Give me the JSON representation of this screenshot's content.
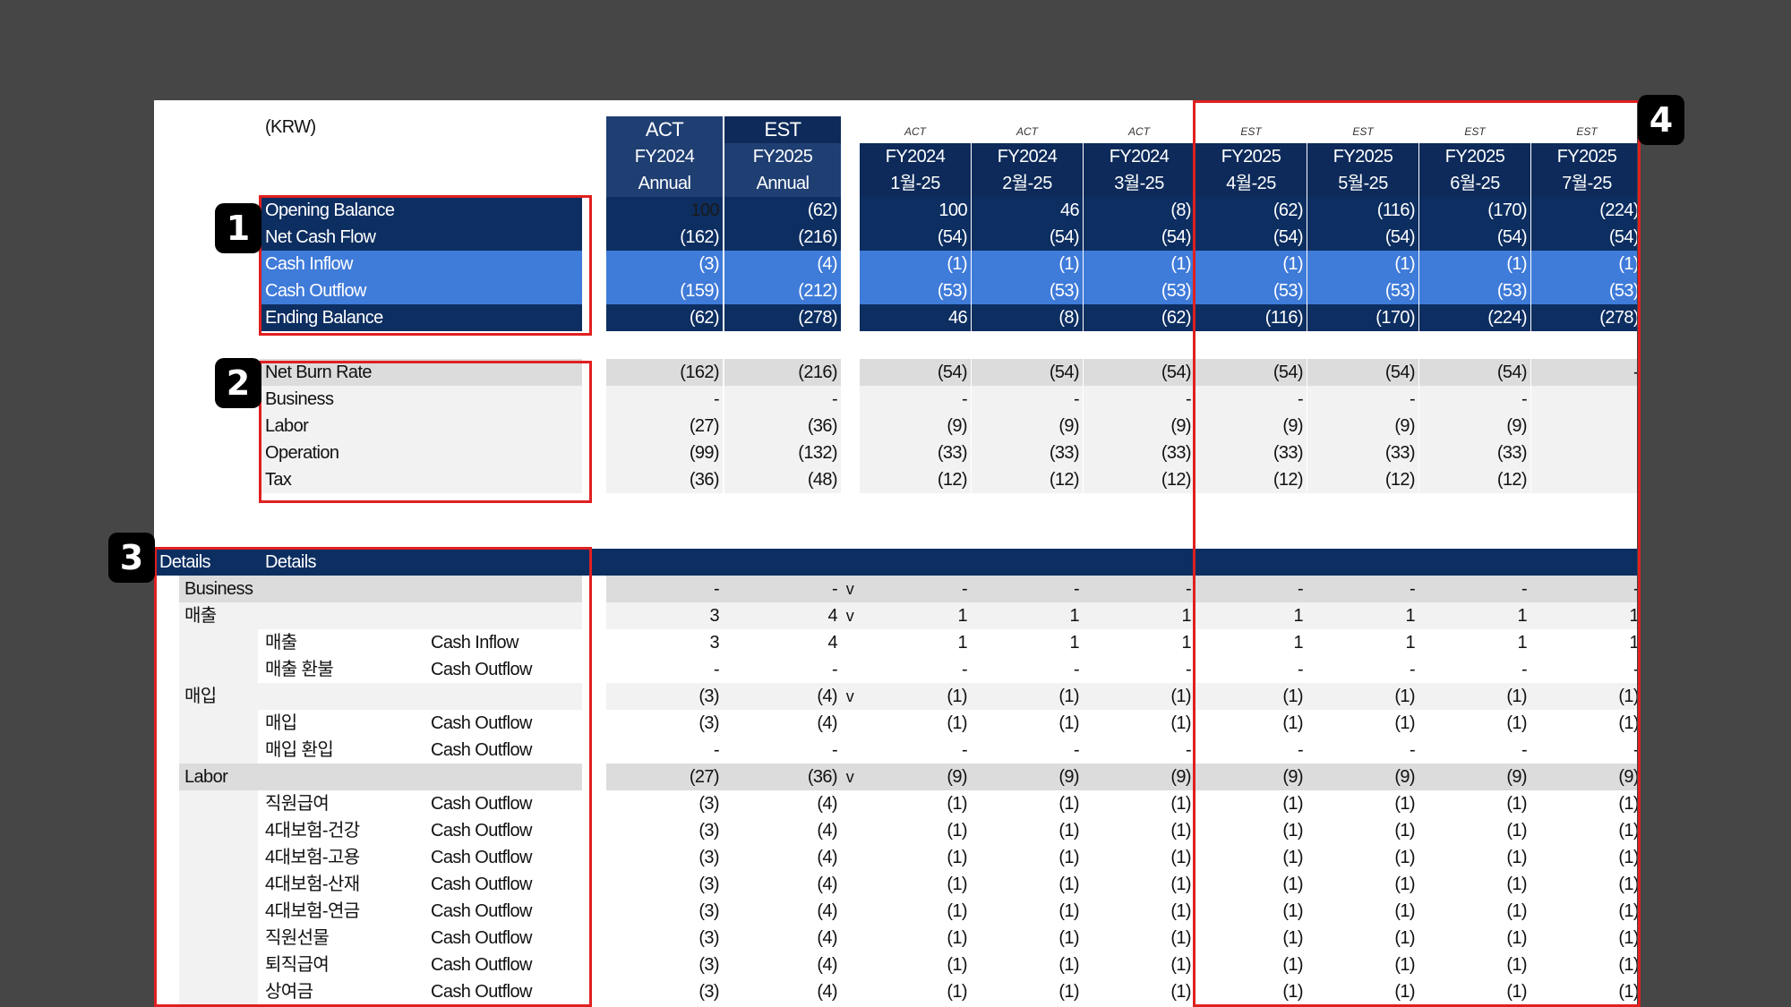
{
  "unit_label": "(KRW)",
  "headers": {
    "summary": [
      {
        "type": "ACT",
        "fy": "FY2024",
        "period": "Annual"
      },
      {
        "type": "EST",
        "fy": "FY2025",
        "period": "Annual"
      }
    ],
    "months": [
      {
        "tag": "ACT",
        "fy": "FY2024",
        "month": "1월-25"
      },
      {
        "tag": "ACT",
        "fy": "FY2024",
        "month": "2월-25"
      },
      {
        "tag": "ACT",
        "fy": "FY2024",
        "month": "3월-25"
      },
      {
        "tag": "EST",
        "fy": "FY2025",
        "month": "4월-25"
      },
      {
        "tag": "EST",
        "fy": "FY2025",
        "month": "5월-25"
      },
      {
        "tag": "EST",
        "fy": "FY2025",
        "month": "6월-25"
      },
      {
        "tag": "EST",
        "fy": "FY2025",
        "month": "7월-25"
      }
    ]
  },
  "balance_rows": [
    {
      "label": "Opening Balance",
      "style": "dark",
      "values": [
        "100",
        "(62)",
        "100",
        "46",
        "(8)",
        "(62)",
        "(116)",
        "(170)",
        "(224)"
      ]
    },
    {
      "label": "Net Cash Flow",
      "style": "dark",
      "values": [
        "(162)",
        "(216)",
        "(54)",
        "(54)",
        "(54)",
        "(54)",
        "(54)",
        "(54)",
        "(54)"
      ]
    },
    {
      "label": "Cash Inflow",
      "style": "blue",
      "values": [
        "(3)",
        "(4)",
        "(1)",
        "(1)",
        "(1)",
        "(1)",
        "(1)",
        "(1)",
        "(1)"
      ]
    },
    {
      "label": "Cash Outflow",
      "style": "blue",
      "values": [
        "(159)",
        "(212)",
        "(53)",
        "(53)",
        "(53)",
        "(53)",
        "(53)",
        "(53)",
        "(53)"
      ]
    },
    {
      "label": "Ending Balance",
      "style": "dark",
      "values": [
        "(62)",
        "(278)",
        "46",
        "(8)",
        "(62)",
        "(116)",
        "(170)",
        "(224)",
        "(278)"
      ]
    }
  ],
  "burn_rows": [
    {
      "label": "Net Burn Rate",
      "style": "grey",
      "values": [
        "(162)",
        "(216)",
        "(54)",
        "(54)",
        "(54)",
        "(54)",
        "(54)",
        "(54)",
        "-"
      ]
    },
    {
      "label": "Business",
      "style": "light",
      "values": [
        "-",
        "-",
        "-",
        "-",
        "-",
        "-",
        "-",
        "-",
        ""
      ]
    },
    {
      "label": "Labor",
      "style": "light",
      "values": [
        "(27)",
        "(36)",
        "(9)",
        "(9)",
        "(9)",
        "(9)",
        "(9)",
        "(9)",
        ""
      ]
    },
    {
      "label": "Operation",
      "style": "light",
      "values": [
        "(99)",
        "(132)",
        "(33)",
        "(33)",
        "(33)",
        "(33)",
        "(33)",
        "(33)",
        ""
      ]
    },
    {
      "label": "Tax",
      "style": "light",
      "values": [
        "(36)",
        "(48)",
        "(12)",
        "(12)",
        "(12)",
        "(12)",
        "(12)",
        "(12)",
        ""
      ]
    }
  ],
  "details_header": {
    "a": "Details",
    "b": "Details"
  },
  "detail_rows": [
    {
      "kind": "section",
      "label": "Business",
      "values": [
        "-",
        "-",
        "-",
        "-",
        "-",
        "-",
        "-",
        "-",
        "-"
      ],
      "mark": "v"
    },
    {
      "kind": "group",
      "label": "매출",
      "values": [
        "3",
        "4",
        "1",
        "1",
        "1",
        "1",
        "1",
        "1",
        "1"
      ],
      "mark": "v"
    },
    {
      "kind": "item",
      "label": "매출",
      "flow": "Cash Inflow",
      "values": [
        "3",
        "4",
        "1",
        "1",
        "1",
        "1",
        "1",
        "1",
        "1"
      ]
    },
    {
      "kind": "item",
      "label": "매출 환불",
      "flow": "Cash Outflow",
      "values": [
        "-",
        "-",
        "-",
        "-",
        "-",
        "-",
        "-",
        "-",
        "-"
      ]
    },
    {
      "kind": "group",
      "label": "매입",
      "values": [
        "(3)",
        "(4)",
        "(1)",
        "(1)",
        "(1)",
        "(1)",
        "(1)",
        "(1)",
        "(1)"
      ],
      "mark": "v"
    },
    {
      "kind": "item",
      "label": "매입",
      "flow": "Cash Outflow",
      "values": [
        "(3)",
        "(4)",
        "(1)",
        "(1)",
        "(1)",
        "(1)",
        "(1)",
        "(1)",
        "(1)"
      ]
    },
    {
      "kind": "item",
      "label": "매입 환입",
      "flow": "Cash Outflow",
      "values": [
        "-",
        "-",
        "-",
        "-",
        "-",
        "-",
        "-",
        "-",
        "-"
      ]
    },
    {
      "kind": "section",
      "label": "Labor",
      "values": [
        "(27)",
        "(36)",
        "(9)",
        "(9)",
        "(9)",
        "(9)",
        "(9)",
        "(9)",
        "(9)"
      ],
      "mark": "v"
    },
    {
      "kind": "item",
      "label": "직원급여",
      "flow": "Cash Outflow",
      "values": [
        "(3)",
        "(4)",
        "(1)",
        "(1)",
        "(1)",
        "(1)",
        "(1)",
        "(1)",
        "(1)"
      ]
    },
    {
      "kind": "item",
      "label": "4대보험-건강",
      "flow": "Cash Outflow",
      "values": [
        "(3)",
        "(4)",
        "(1)",
        "(1)",
        "(1)",
        "(1)",
        "(1)",
        "(1)",
        "(1)"
      ]
    },
    {
      "kind": "item",
      "label": "4대보험-고용",
      "flow": "Cash Outflow",
      "values": [
        "(3)",
        "(4)",
        "(1)",
        "(1)",
        "(1)",
        "(1)",
        "(1)",
        "(1)",
        "(1)"
      ]
    },
    {
      "kind": "item",
      "label": "4대보험-산재",
      "flow": "Cash Outflow",
      "values": [
        "(3)",
        "(4)",
        "(1)",
        "(1)",
        "(1)",
        "(1)",
        "(1)",
        "(1)",
        "(1)"
      ]
    },
    {
      "kind": "item",
      "label": "4대보험-연금",
      "flow": "Cash Outflow",
      "values": [
        "(3)",
        "(4)",
        "(1)",
        "(1)",
        "(1)",
        "(1)",
        "(1)",
        "(1)",
        "(1)"
      ]
    },
    {
      "kind": "item",
      "label": "직원선물",
      "flow": "Cash Outflow",
      "values": [
        "(3)",
        "(4)",
        "(1)",
        "(1)",
        "(1)",
        "(1)",
        "(1)",
        "(1)",
        "(1)"
      ]
    },
    {
      "kind": "item",
      "label": "퇴직급여",
      "flow": "Cash Outflow",
      "values": [
        "(3)",
        "(4)",
        "(1)",
        "(1)",
        "(1)",
        "(1)",
        "(1)",
        "(1)",
        "(1)"
      ]
    },
    {
      "kind": "item",
      "label": "상여금",
      "flow": "Cash Outflow",
      "values": [
        "(3)",
        "(4)",
        "(1)",
        "(1)",
        "(1)",
        "(1)",
        "(1)",
        "(1)",
        "(1)"
      ]
    }
  ],
  "callouts": [
    "1",
    "2",
    "3",
    "4"
  ]
}
